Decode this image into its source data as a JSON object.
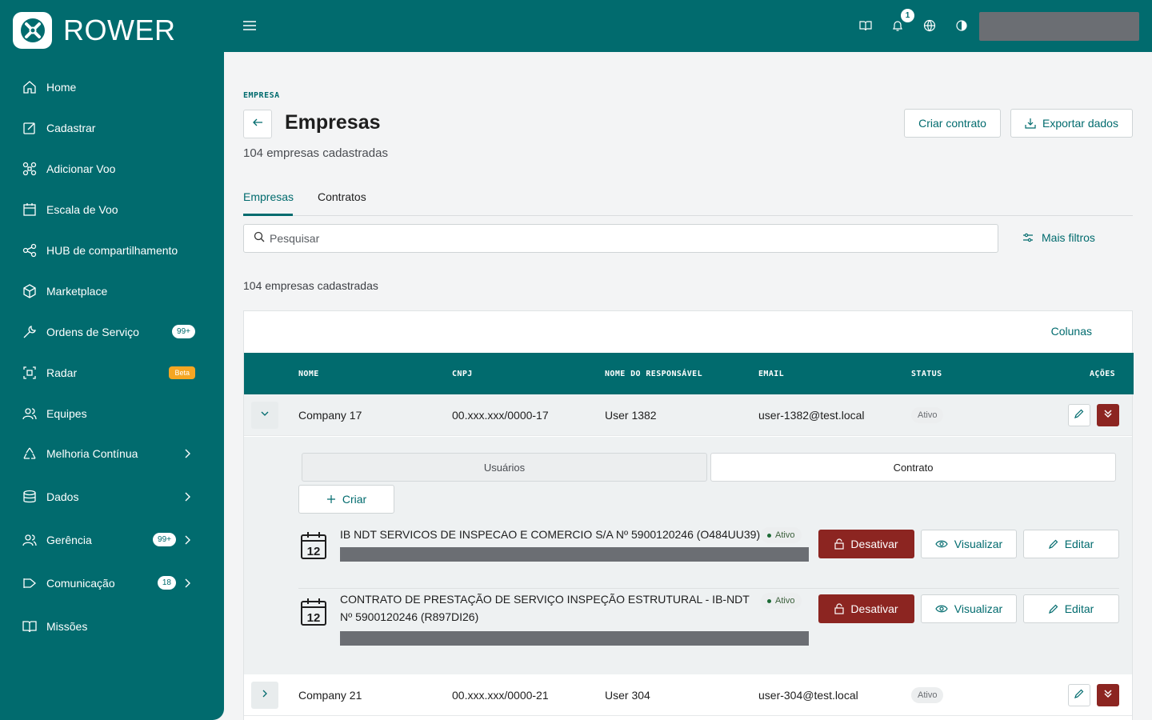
{
  "app": {
    "logo_text": "ROWER"
  },
  "sidebar": {
    "items": [
      {
        "label": "Home",
        "icon": "home-icon"
      },
      {
        "label": "Cadastrar",
        "icon": "edit-icon"
      },
      {
        "label": "Adicionar Voo",
        "icon": "drone-icon"
      },
      {
        "label": "Escala de Voo",
        "icon": "calendar-icon"
      },
      {
        "label": "HUB de compartilhamento",
        "icon": "share-icon"
      },
      {
        "label": "Marketplace",
        "icon": "box-icon"
      },
      {
        "label": "Ordens de Serviço",
        "icon": "wrench-icon",
        "badge": "99+"
      },
      {
        "label": "Radar",
        "icon": "radar-icon",
        "tag": "Beta"
      },
      {
        "label": "Equipes",
        "icon": "users-icon"
      },
      {
        "label": "Melhoria Contínua",
        "icon": "recycle-icon"
      },
      {
        "label": "Dados",
        "icon": "database-icon"
      },
      {
        "label": "Gerência",
        "icon": "users-icon",
        "badge": "99+"
      },
      {
        "label": "Comunicação",
        "icon": "megaphone-icon",
        "badge": "18"
      },
      {
        "label": "Missões",
        "icon": "book-icon"
      }
    ]
  },
  "topbar": {
    "notification_count": "1"
  },
  "page": {
    "eyebrow": "EMPRESA",
    "title": "Empresas",
    "subtitle": "104 empresas cadastradas",
    "create_contract": "Criar contrato",
    "export": "Exportar dados"
  },
  "tabs": [
    {
      "label": "Empresas"
    },
    {
      "label": "Contratos"
    }
  ],
  "search": {
    "placeholder": "Pesquisar",
    "filters_label": "Mais filtros"
  },
  "list": {
    "count": "104 empresas cadastradas",
    "columns_label": "Colunas",
    "headers": [
      "NOME",
      "CNPJ",
      "NOME DO RESPONSÁVEL",
      "EMAIL",
      "STATUS",
      "AÇÕES"
    ],
    "rows": [
      {
        "name": "Company 17",
        "cnpj": "00.xxx.xxx/0000-17",
        "responsible": "User 1382",
        "email": "user-1382@test.local",
        "status": "Ativo"
      },
      {
        "name": "Company 21",
        "cnpj": "00.xxx.xxx/0000-21",
        "responsible": "User 304",
        "email": "user-304@test.local",
        "status": "Ativo"
      }
    ]
  },
  "detail": {
    "subtabs": [
      "Usuários",
      "Contrato"
    ],
    "create_label": "Criar",
    "contracts": [
      {
        "title": "IB NDT SERVICOS DE INSPECAO E COMERCIO S/A Nº 5900120246 (O484UU39)",
        "status": "Ativo",
        "calendar_day": "12"
      },
      {
        "title": "CONTRATO DE PRESTAÇÃO DE SERVIÇO INSPEÇÃO ESTRUTURAL - IB-NDT Nº 5900120246 (R897DI26)",
        "status": "Ativo",
        "calendar_day": "12"
      }
    ],
    "deactivate_label": "Desativar",
    "view_label": "Visualizar",
    "edit_label": "Editar"
  },
  "colors": {
    "primary": "#016b6e",
    "danger": "#8c2521",
    "beta": "#f5a623"
  }
}
